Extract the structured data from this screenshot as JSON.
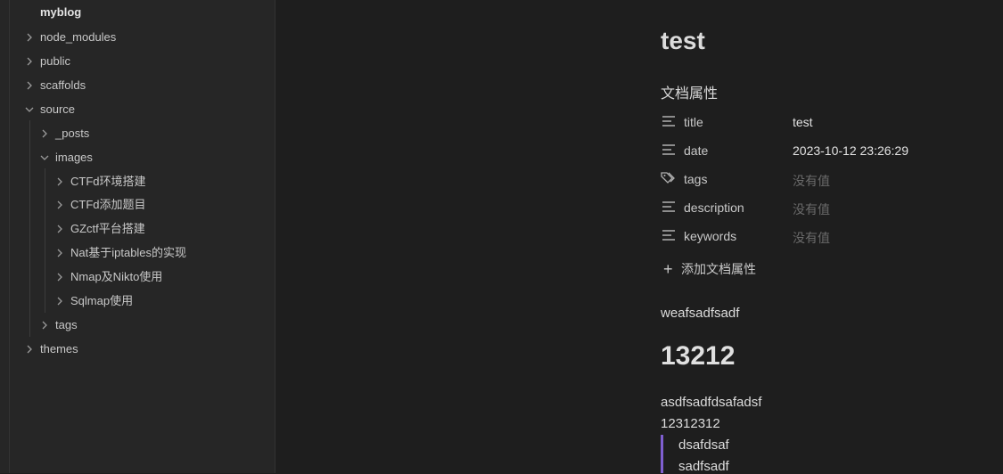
{
  "explorer": {
    "root": "myblog",
    "items": [
      {
        "label": "node_modules"
      },
      {
        "label": "public"
      },
      {
        "label": "scaffolds"
      },
      {
        "label": "source"
      },
      {
        "label": "_posts"
      },
      {
        "label": "images"
      },
      {
        "label": "CTFd环境搭建"
      },
      {
        "label": "CTFd添加题目"
      },
      {
        "label": "GZctf平台搭建"
      },
      {
        "label": "Nat基于iptables的实现"
      },
      {
        "label": "Nmap及Nikto使用"
      },
      {
        "label": "Sqlmap使用"
      },
      {
        "label": "tags"
      },
      {
        "label": "themes"
      }
    ]
  },
  "doc": {
    "title": "test",
    "properties_heading": "文档属性",
    "properties": [
      {
        "icon": "text-lines-icon",
        "key": "title",
        "value": "test"
      },
      {
        "icon": "text-lines-icon",
        "key": "date",
        "value": "2023-10-12 23:26:29"
      },
      {
        "icon": "tags-icon",
        "key": "tags",
        "value": "没有值"
      },
      {
        "icon": "text-lines-icon",
        "key": "description",
        "value": "没有值"
      },
      {
        "icon": "text-lines-icon",
        "key": "keywords",
        "value": "没有值"
      }
    ],
    "add_property": "添加文档属性",
    "paragraph1": "weafsadfsadf",
    "heading2": "13212",
    "paragraph2_line1": "asdfsadfdsafadsf",
    "paragraph2_line2": "12312312",
    "quote_lines": [
      "dsafdsaf",
      "sadfsadf"
    ]
  }
}
